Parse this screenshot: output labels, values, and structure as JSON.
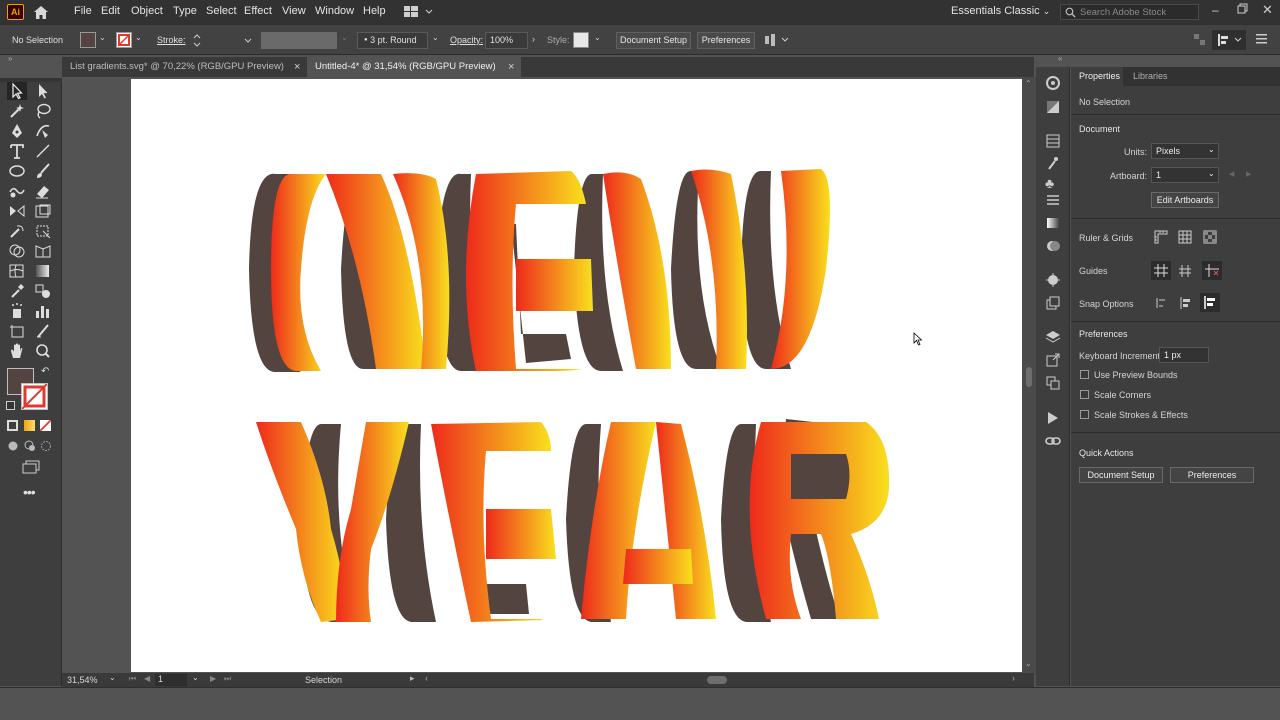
{
  "app": {
    "logo": "Ai",
    "workspace": "Essentials Classic",
    "search_placeholder": "Search Adobe Stock"
  },
  "menu": [
    "File",
    "Edit",
    "Object",
    "Type",
    "Select",
    "Effect",
    "View",
    "Window",
    "Help"
  ],
  "control_bar": {
    "selection_label": "No Selection",
    "stroke_label": "Stroke:",
    "brush_label": "3 pt. Round",
    "opacity_label": "Opacity:",
    "opacity_value": "100%",
    "style_label": "Style:",
    "document_setup": "Document Setup",
    "preferences": "Preferences"
  },
  "tabs": [
    {
      "label": "List gradients.svg* @ 70,22% (RGB/GPU Preview)",
      "active": false
    },
    {
      "label": "Untitled-4* @ 31,54% (RGB/GPU Preview)",
      "active": true
    }
  ],
  "canvas": {
    "line1": "NEW",
    "line2": "YEAR",
    "shadow_color": "#53443f",
    "gradient_start": "#ee2a1b",
    "gradient_end": "#f9e01d"
  },
  "status_bar": {
    "zoom": "31,54%",
    "artboard_number": "1",
    "tool": "Selection"
  },
  "properties": {
    "tab_properties": "Properties",
    "tab_libraries": "Libraries",
    "no_selection": "No Selection",
    "document_header": "Document",
    "units_label": "Units:",
    "units_value": "Pixels",
    "artboard_label": "Artboard:",
    "artboard_value": "1",
    "edit_artboards": "Edit Artboards",
    "rulers_label": "Ruler & Grids",
    "guides_label": "Guides",
    "snap_label": "Snap Options",
    "preferences_header": "Preferences",
    "keyboard_label": "Keyboard Increment:",
    "keyboard_value": "1 px",
    "use_preview_bounds": "Use Preview Bounds",
    "scale_corners": "Scale Corners",
    "scale_strokes": "Scale Strokes & Effects",
    "quick_actions": "Quick Actions",
    "document_setup": "Document Setup",
    "preferences_btn": "Preferences"
  },
  "colors": {
    "ai_logo": "#ff9a00",
    "fill_swatch": "#53443f"
  }
}
